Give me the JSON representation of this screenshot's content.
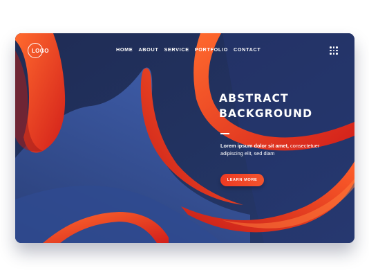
{
  "brand": {
    "logo_text": "LOGO"
  },
  "nav": {
    "items": [
      {
        "label": "HOME"
      },
      {
        "label": "ABOUT"
      },
      {
        "label": "SERVICE"
      },
      {
        "label": "PORTFOLIO"
      },
      {
        "label": "CONTACT"
      }
    ],
    "menu_icon": "grid-menu-icon"
  },
  "hero": {
    "title_line1": "ABSTRACT",
    "title_line2": "BACKGROUND",
    "body_bold": "Lorem ipsum dolor sit amet,",
    "body_rest": " consectetuer adipiscing elit, sed diam",
    "cta_label": "LEARN MORE"
  },
  "colors": {
    "background_navy": "#21325e",
    "accent_orange": "#f04a2a",
    "accent_red": "#d8231c",
    "text": "#ffffff"
  }
}
